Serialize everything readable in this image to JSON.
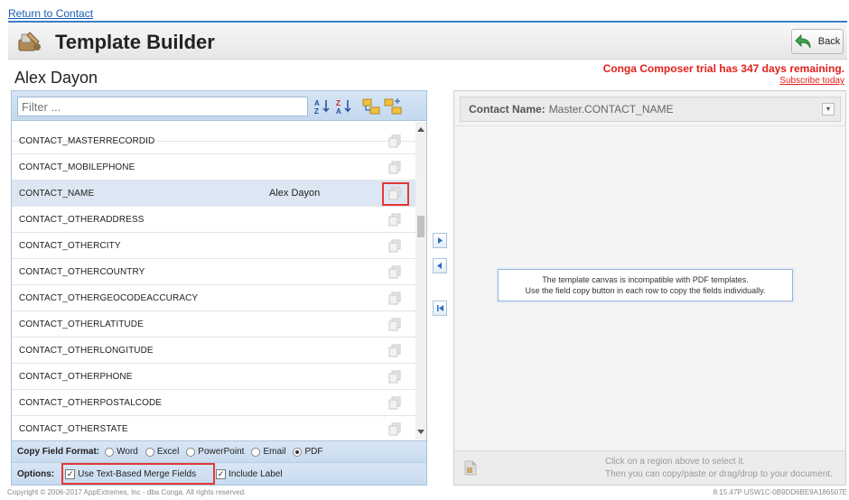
{
  "nav": {
    "return_label": "Return to Contact"
  },
  "header": {
    "title": "Template Builder",
    "back_label": "Back"
  },
  "contact": {
    "name": "Alex Dayon"
  },
  "trial": {
    "message": "Conga Composer trial has 347 days remaining.",
    "subscribe_label": "Subscribe today"
  },
  "filter": {
    "placeholder": "Filter ..."
  },
  "fields": [
    {
      "name": "CONTACT_MASTERRECORDID",
      "value": ""
    },
    {
      "name": "CONTACT_MOBILEPHONE",
      "value": ""
    },
    {
      "name": "CONTACT_NAME",
      "value": "Alex Dayon",
      "selected": true
    },
    {
      "name": "CONTACT_OTHERADDRESS",
      "value": ""
    },
    {
      "name": "CONTACT_OTHERCITY",
      "value": ""
    },
    {
      "name": "CONTACT_OTHERCOUNTRY",
      "value": ""
    },
    {
      "name": "CONTACT_OTHERGEOCODEACCURACY",
      "value": ""
    },
    {
      "name": "CONTACT_OTHERLATITUDE",
      "value": ""
    },
    {
      "name": "CONTACT_OTHERLONGITUDE",
      "value": ""
    },
    {
      "name": "CONTACT_OTHERPHONE",
      "value": ""
    },
    {
      "name": "CONTACT_OTHERPOSTALCODE",
      "value": ""
    },
    {
      "name": "CONTACT_OTHERSTATE",
      "value": ""
    }
  ],
  "copy_format": {
    "label": "Copy Field Format:",
    "options": [
      "Word",
      "Excel",
      "PowerPoint",
      "Email",
      "PDF"
    ],
    "selected": "PDF"
  },
  "options": {
    "label": "Options:",
    "use_text_merge": "Use Text-Based Merge Fields",
    "include_label": "Include Label"
  },
  "canvas": {
    "header_label": "Contact Name:",
    "header_value": "Master.CONTACT_NAME",
    "notice_line1": "The template canvas is incompatible with PDF templates.",
    "notice_line2": "Use the field copy button in each row to copy the fields individually.",
    "hint_line1": "Click on a region above to select it.",
    "hint_line2": "Then you can copy/paste or drag/drop to your document."
  },
  "footer": {
    "copyright": "Copyright © 2006-2017 AppExtremes, Inc - dba Conga. All rights reserved.",
    "version": "8.15.47P USW1C-0B9DD6BE9A186507E"
  },
  "colors": {
    "accent": "#3a7cc8",
    "link": "#1a5cb4",
    "alert": "#e0201b",
    "highlight": "#e53935"
  }
}
